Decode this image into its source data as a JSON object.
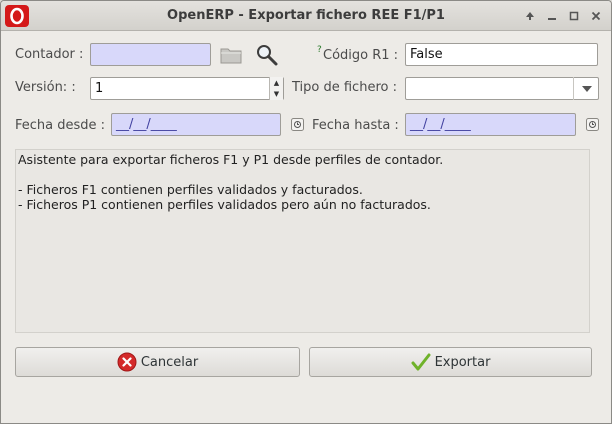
{
  "window": {
    "title": "OpenERP - Exportar fichero REE F1/P1"
  },
  "form": {
    "contador": {
      "label": "Contador :",
      "value": ""
    },
    "codigo_r1": {
      "help_mark": "?",
      "label": "Código R1 :",
      "value": "False"
    },
    "version": {
      "label": "Versión: :",
      "value": "1"
    },
    "tipo_fichero": {
      "label": "Tipo de fichero :",
      "value": ""
    },
    "fecha_desde": {
      "label": "Fecha desde :",
      "value": "__/__/____"
    },
    "fecha_hasta": {
      "label": "Fecha hasta :",
      "value": "__/__/____"
    }
  },
  "info_text": "Asistente para exportar ficheros F1 y P1 desde perfiles de contador.\n\n- Ficheros F1 contienen perfiles validados y facturados.\n- Ficheros P1 contienen perfiles validados pero aún no facturados.",
  "buttons": {
    "cancel": "Cancelar",
    "export": "Exportar"
  },
  "icons": {
    "app": "openerp-logo-icon",
    "folder": "folder-icon",
    "search": "search-icon",
    "calendar": "calendar-icon",
    "cancel": "cancel-icon",
    "export": "checkmark-icon"
  },
  "colors": {
    "required_field": "#d8d8fa",
    "logo": "#d41919",
    "cancel_icon": "#d42a2a",
    "check": "#6fb22a"
  }
}
